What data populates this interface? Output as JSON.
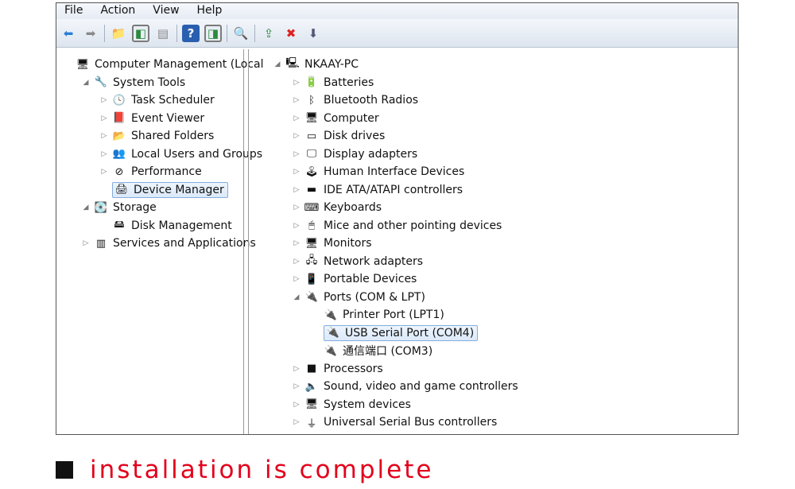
{
  "menu": [
    "File",
    "Action",
    "View",
    "Help"
  ],
  "toolbar_icons": [
    "back-arrow-icon",
    "forward-arrow-icon",
    "up-folder-icon",
    "show-hide-console-tree-icon",
    "properties-icon",
    "help-icon",
    "show-hide-action-pane-icon",
    "scan-hardware-icon",
    "update-driver-icon",
    "uninstall-icon",
    "disable-device-icon"
  ],
  "left_tree": [
    {
      "label": "Computer Management (Local",
      "level": 0,
      "icon": "computer-management-icon",
      "expander": ""
    },
    {
      "label": "System Tools",
      "level": 1,
      "icon": "tools-icon",
      "expander": "◢"
    },
    {
      "label": "Task Scheduler",
      "level": 2,
      "icon": "clock-icon",
      "expander": "▷"
    },
    {
      "label": "Event Viewer",
      "level": 2,
      "icon": "event-viewer-icon",
      "expander": "▷"
    },
    {
      "label": "Shared Folders",
      "level": 2,
      "icon": "shared-folder-icon",
      "expander": "▷"
    },
    {
      "label": "Local Users and Groups",
      "level": 2,
      "icon": "users-icon",
      "expander": "▷"
    },
    {
      "label": "Performance",
      "level": 2,
      "icon": "performance-icon",
      "expander": "▷"
    },
    {
      "label": "Device Manager",
      "level": 2,
      "icon": "device-manager-icon",
      "expander": "",
      "selected": true
    },
    {
      "label": "Storage",
      "level": 1,
      "icon": "storage-icon",
      "expander": "◢"
    },
    {
      "label": "Disk Management",
      "level": 2,
      "icon": "disk-icon",
      "expander": ""
    },
    {
      "label": "Services and Applications",
      "level": 1,
      "icon": "services-icon",
      "expander": "▷"
    }
  ],
  "right_tree": [
    {
      "label": "NKAAY-PC",
      "level": 0,
      "icon": "computer-icon",
      "expander": "◢"
    },
    {
      "label": "Batteries",
      "level": 1,
      "icon": "battery-icon",
      "expander": "▷"
    },
    {
      "label": "Bluetooth Radios",
      "level": 1,
      "icon": "bluetooth-icon",
      "expander": "▷"
    },
    {
      "label": "Computer",
      "level": 1,
      "icon": "monitor-icon",
      "expander": "▷"
    },
    {
      "label": "Disk drives",
      "level": 1,
      "icon": "disk-drive-icon",
      "expander": "▷"
    },
    {
      "label": "Display adapters",
      "level": 1,
      "icon": "display-adapter-icon",
      "expander": "▷"
    },
    {
      "label": "Human Interface Devices",
      "level": 1,
      "icon": "hid-icon",
      "expander": "▷"
    },
    {
      "label": "IDE ATA/ATAPI controllers",
      "level": 1,
      "icon": "ide-icon",
      "expander": "▷"
    },
    {
      "label": "Keyboards",
      "level": 1,
      "icon": "keyboard-icon",
      "expander": "▷"
    },
    {
      "label": "Mice and other pointing devices",
      "level": 1,
      "icon": "mouse-icon",
      "expander": "▷"
    },
    {
      "label": "Monitors",
      "level": 1,
      "icon": "monitor-icon",
      "expander": "▷"
    },
    {
      "label": "Network adapters",
      "level": 1,
      "icon": "network-icon",
      "expander": "▷"
    },
    {
      "label": "Portable Devices",
      "level": 1,
      "icon": "portable-device-icon",
      "expander": "▷"
    },
    {
      "label": "Ports (COM & LPT)",
      "level": 1,
      "icon": "port-icon",
      "expander": "◢"
    },
    {
      "label": "Printer Port (LPT1)",
      "level": 2,
      "icon": "port-icon",
      "expander": ""
    },
    {
      "label": "USB Serial Port (COM4)",
      "level": 2,
      "icon": "port-icon",
      "expander": "",
      "selected": true
    },
    {
      "label": "通信端口 (COM3)",
      "level": 2,
      "icon": "port-icon",
      "expander": ""
    },
    {
      "label": "Processors",
      "level": 1,
      "icon": "processor-icon",
      "expander": "▷"
    },
    {
      "label": "Sound, video and game controllers",
      "level": 1,
      "icon": "speaker-icon",
      "expander": "▷"
    },
    {
      "label": "System devices",
      "level": 1,
      "icon": "system-device-icon",
      "expander": "▷"
    },
    {
      "label": "Universal Serial Bus controllers",
      "level": 1,
      "icon": "usb-icon",
      "expander": "▷"
    }
  ],
  "caption": "installation is complete",
  "colors": {
    "caption": "#e3001b",
    "selection": "#dbe9fa"
  }
}
